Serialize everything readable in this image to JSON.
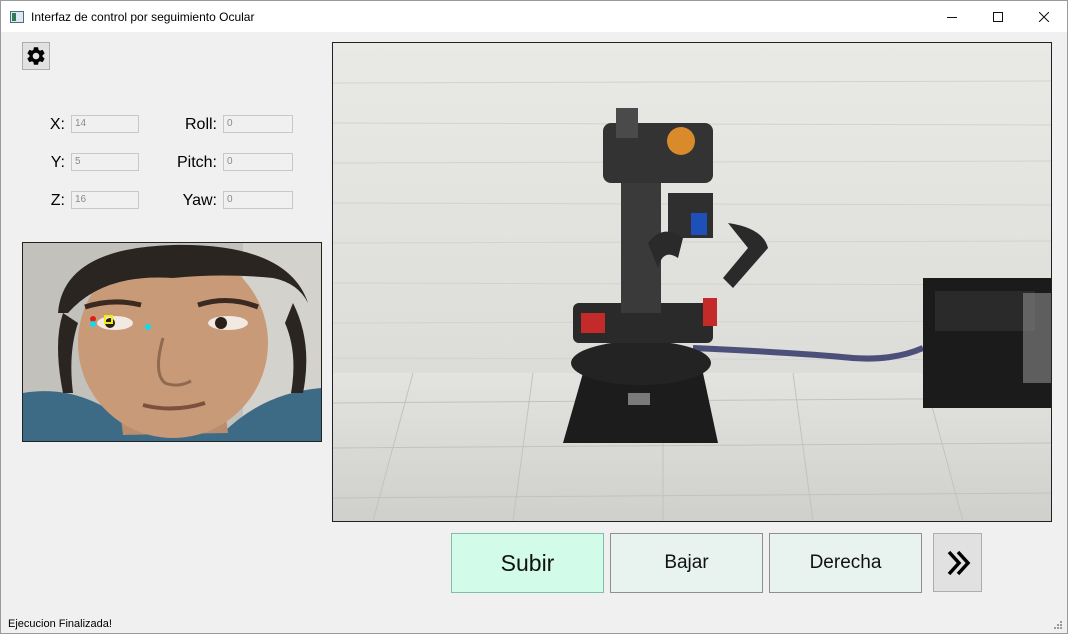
{
  "window": {
    "title": "Interfaz de control por seguimiento Ocular",
    "icons": {
      "app": "app-window-icon",
      "minimize": "minimize-icon",
      "maximize": "maximize-icon",
      "close": "close-icon"
    }
  },
  "settings": {
    "icon": "gear-icon"
  },
  "position": {
    "x": {
      "label": "X:",
      "value": "14"
    },
    "y": {
      "label": "Y:",
      "value": "5"
    },
    "z": {
      "label": "Z:",
      "value": "16"
    }
  },
  "orientation": {
    "roll": {
      "label": "Roll:",
      "value": "0"
    },
    "pitch": {
      "label": "Pitch:",
      "value": "0"
    },
    "yaw": {
      "label": "Yaw:",
      "value": "0"
    }
  },
  "face_camera": {
    "content": "face-tracking-video-feed",
    "markers": [
      "red",
      "cyan",
      "yellow"
    ]
  },
  "robot_camera": {
    "content": "robot-arm-video-feed"
  },
  "controls": {
    "up_label": "Subir",
    "down_label": "Bajar",
    "right_label": "Derecha",
    "next_icon": "double-chevron-right-icon"
  },
  "status": {
    "text": "Ejecucion Finalizada!"
  },
  "colors": {
    "primary_button": "#d3fbea",
    "secondary_button": "#e8f3ef",
    "window_background": "#f0f0f0"
  }
}
